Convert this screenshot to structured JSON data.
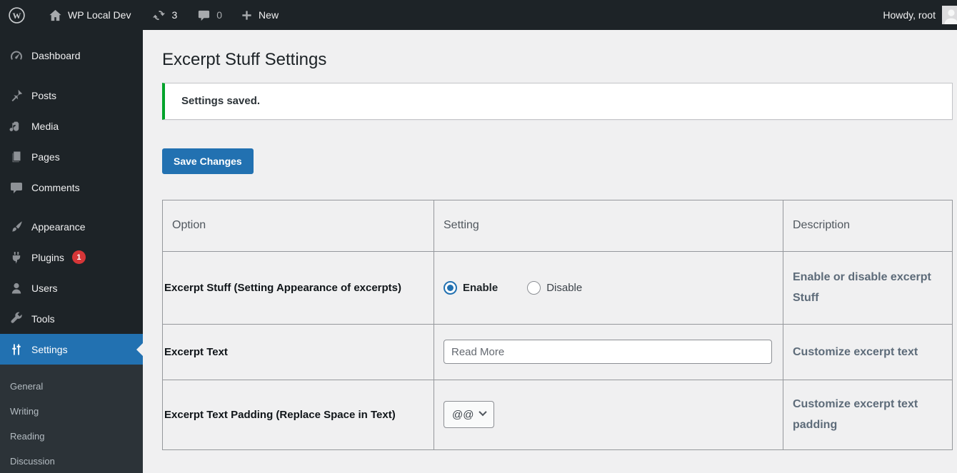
{
  "admin_bar": {
    "site_name": "WP Local Dev",
    "updates_count": "3",
    "comments_count": "0",
    "new_label": "New",
    "howdy": "Howdy, root"
  },
  "sidebar": {
    "items": [
      {
        "icon": "dashboard-icon",
        "label": "Dashboard"
      },
      {
        "icon": "pin-icon",
        "label": "Posts"
      },
      {
        "icon": "media-icon",
        "label": "Media"
      },
      {
        "icon": "pages-icon",
        "label": "Pages"
      },
      {
        "icon": "comments-icon",
        "label": "Comments"
      },
      {
        "icon": "appearance-icon",
        "label": "Appearance"
      },
      {
        "icon": "plugins-icon",
        "label": "Plugins",
        "badge": "1"
      },
      {
        "icon": "users-icon",
        "label": "Users"
      },
      {
        "icon": "tools-icon",
        "label": "Tools"
      },
      {
        "icon": "settings-icon",
        "label": "Settings",
        "active": true
      }
    ],
    "settings_submenu": [
      {
        "label": "General"
      },
      {
        "label": "Writing"
      },
      {
        "label": "Reading"
      },
      {
        "label": "Discussion"
      }
    ]
  },
  "main": {
    "page_title": "Excerpt Stuff Settings",
    "notice": "Settings saved.",
    "save_button": "Save Changes",
    "table": {
      "headers": [
        "Option",
        "Setting",
        "Description"
      ],
      "rows": [
        {
          "option": "Excerpt Stuff (Setting Appearance of excerpts)",
          "control": "radio",
          "radio_options": [
            {
              "label": "Enable",
              "checked": true
            },
            {
              "label": "Disable",
              "checked": false
            }
          ],
          "description": "Enable or disable excerpt Stuff"
        },
        {
          "option": "Excerpt Text",
          "control": "text",
          "value": "Read More",
          "description": "Customize excerpt text"
        },
        {
          "option": "Excerpt Text Padding (Replace Space in Text)",
          "control": "select",
          "selected": "@@",
          "description": "Customize excerpt text padding"
        }
      ]
    }
  },
  "colors": {
    "accent_blue": "#2271b1",
    "notice_green": "#00a32a",
    "badge_red": "#d63638",
    "bar_bg": "#1d2327",
    "submenu_bg": "#2c3338",
    "page_bg": "#f0f0f1"
  }
}
